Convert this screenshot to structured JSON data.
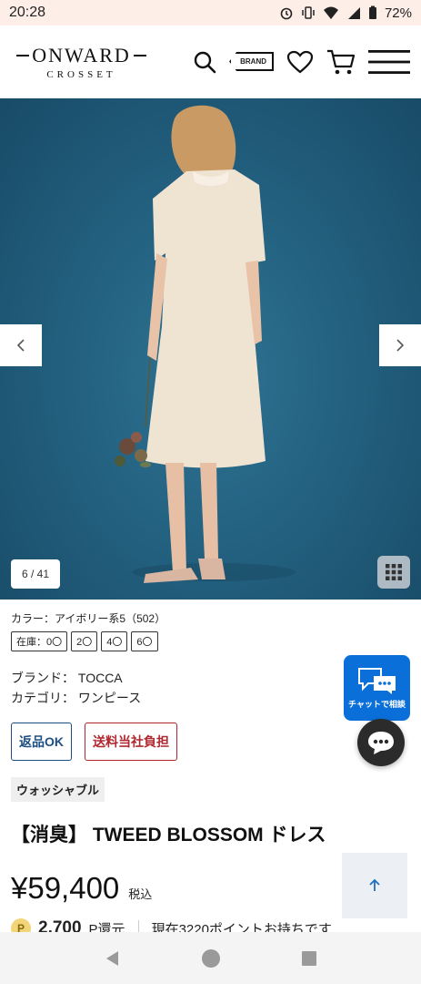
{
  "status_bar": {
    "time": "20:28",
    "battery": "72%"
  },
  "header": {
    "logo_main": "ONWARD",
    "logo_sub": "CROSSET",
    "brand_label": "BRAND"
  },
  "gallery": {
    "counter": "6 / 41"
  },
  "product": {
    "color_line": "カラー：アイボリー系5（502）",
    "sizes": [
      "在庫：0〇",
      "2〇",
      "4〇",
      "6〇"
    ],
    "brand_line": "ブランド： TOCCA",
    "category_line": "カテゴリ： ワンピース",
    "badge_return": "返品OK",
    "badge_shipping": "送料当社負担",
    "washable": "ウォッシャブル",
    "title": "【消臭】 TWEED BLOSSOM ドレス",
    "price": "¥59,400",
    "tax": "税込",
    "points_icon": "P",
    "points": "2,700",
    "points_suffix": "P還元",
    "points_note": "現在3220ポイントお持ちです"
  },
  "chat": {
    "label": "チャットで相談"
  },
  "colors": {
    "chat_blue": "#0a6fd8",
    "return_blue": "#1f4f82",
    "shipping_red": "#b0282f",
    "hero_bg": "#215d7c"
  }
}
